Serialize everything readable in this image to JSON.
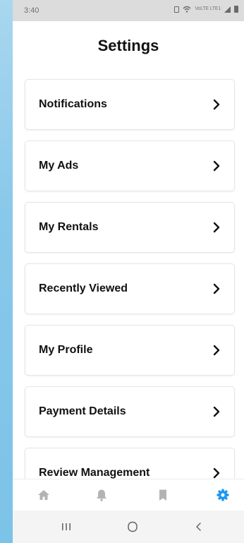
{
  "status_bar": {
    "time": "3:40",
    "network_label": "VoLTE LTE1",
    "icons": [
      "sim-icon",
      "wifi-icon",
      "signal-icon",
      "battery-icon"
    ]
  },
  "header": {
    "title": "Settings"
  },
  "settings_items": [
    {
      "label": "Notifications"
    },
    {
      "label": "My Ads"
    },
    {
      "label": "My Rentals"
    },
    {
      "label": "Recently Viewed"
    },
    {
      "label": "My Profile"
    },
    {
      "label": "Payment Details"
    },
    {
      "label": "Review Management"
    }
  ],
  "tab_bar": {
    "tabs": [
      {
        "icon": "home-icon",
        "active": false
      },
      {
        "icon": "bell-icon",
        "active": false
      },
      {
        "icon": "bookmark-icon",
        "active": false
      },
      {
        "icon": "gear-icon",
        "active": true
      }
    ],
    "active_color": "#1a96f0",
    "inactive_color": "#b3b3b3"
  },
  "system_nav": {
    "buttons": [
      "recent-apps-icon",
      "home-circle-icon",
      "back-icon"
    ]
  }
}
